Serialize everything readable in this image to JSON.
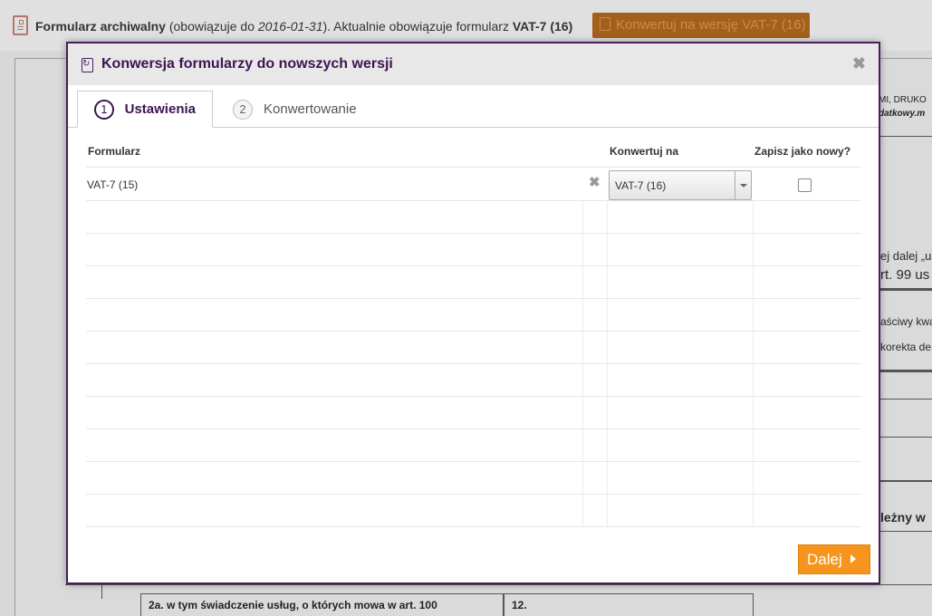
{
  "background": {
    "archive_notice": {
      "label": "Formularz archiwalny",
      "text_before_date": "(obowiązuje do ",
      "date": "2016-01-31",
      "text_after_date": "). Aktualnie obowiązuje formularz",
      "current_form": "VAT-7 (16)"
    },
    "convert_button_label": "Konwertuj na wersję VAT-7 (16)",
    "fragments": {
      "tr1": "MI, DRUKO",
      "tr2": "datkowy.m",
      "f1": "ej dalej „us",
      "f2": "rt. 99 us",
      "f3": "aściwy kwa",
      "f4": "korekta de",
      "f5": "leżny w"
    },
    "bottom_row": {
      "left_cell": "2a. w tym świadczenie usług, o których mowa w art. 100",
      "right_cell": "12."
    }
  },
  "modal": {
    "title": "Konwersja formularzy do nowszych wersji",
    "close_symbol": "✖",
    "tabs": [
      {
        "number": "1",
        "label": "Ustawienia",
        "active": true
      },
      {
        "number": "2",
        "label": "Konwertowanie",
        "active": false
      }
    ],
    "table": {
      "headers": {
        "form": "Formularz",
        "convert_to": "Konwertuj na",
        "save_as_new": "Zapisz jako nowy?"
      },
      "rows": [
        {
          "form": "VAT-7 (15)",
          "convert_to": "VAT-7 (16)",
          "save_as_new": false,
          "remove_symbol": "✖"
        }
      ]
    },
    "next_button_label": "Dalej"
  },
  "colors": {
    "accent_purple": "#3d1452",
    "next_button": "#f7941d",
    "bg_convert_button": "#a3601c"
  }
}
